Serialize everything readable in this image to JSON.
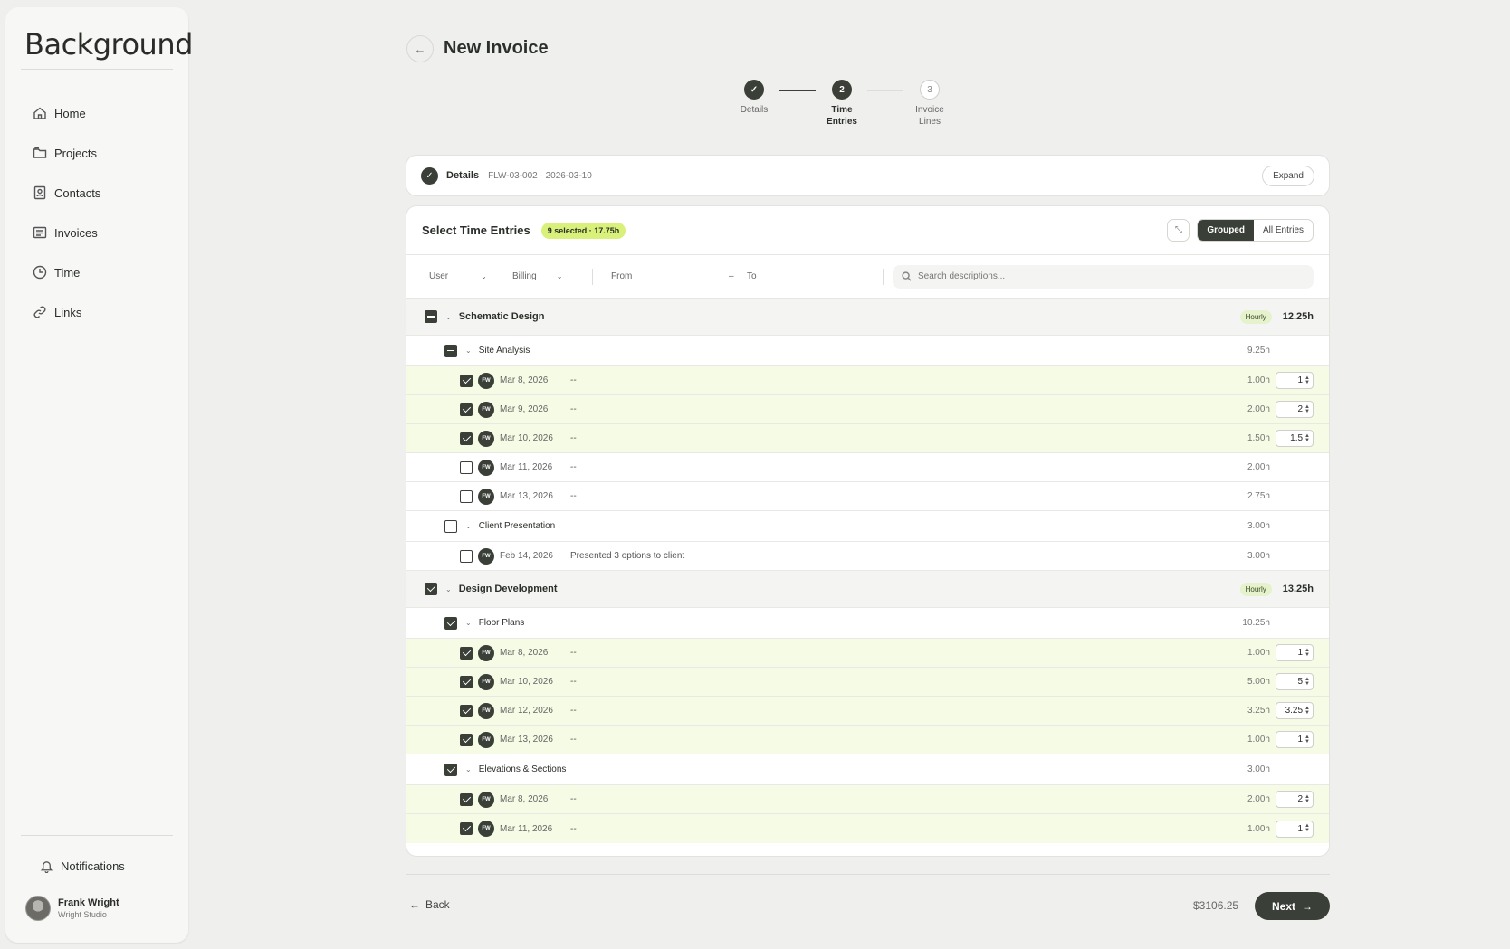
{
  "app": {
    "logo": "Background"
  },
  "sidebar": {
    "items": [
      {
        "label": "Home",
        "icon": "home-icon"
      },
      {
        "label": "Projects",
        "icon": "folder-icon"
      },
      {
        "label": "Contacts",
        "icon": "contact-card-icon"
      },
      {
        "label": "Invoices",
        "icon": "invoice-icon"
      },
      {
        "label": "Time",
        "icon": "clock-icon"
      },
      {
        "label": "Links",
        "icon": "link-icon"
      }
    ],
    "notifications": "Notifications",
    "user": {
      "name": "Frank Wright",
      "org": "Wright Studio"
    }
  },
  "page": {
    "title": "New Invoice"
  },
  "stepper": [
    {
      "num": "✓",
      "label": "Details",
      "state": "done"
    },
    {
      "num": "2",
      "label": "Time Entries",
      "state": "active"
    },
    {
      "num": "3",
      "label": "Invoice Lines",
      "state": "todo"
    }
  ],
  "details": {
    "title": "Details",
    "meta": "FLW-03-002 · 2026-03-10",
    "expand": "Expand"
  },
  "entries": {
    "title": "Select Time Entries",
    "badge": "9 selected · 17.75h",
    "view_grouped": "Grouped",
    "view_all": "All Entries",
    "filters": {
      "user": "User",
      "billing": "Billing",
      "from": "From",
      "dash": "–",
      "to": "To",
      "search_placeholder": "Search descriptions..."
    },
    "groups": [
      {
        "name": "Schematic Design",
        "billing": "Hourly",
        "total": "12.25h",
        "state": "partial",
        "subgroups": [
          {
            "name": "Site Analysis",
            "total": "9.25h",
            "state": "partial",
            "rows": [
              {
                "initials": "FW",
                "date": "Mar 8, 2026",
                "desc": "--",
                "hours": "1.00h",
                "qty": "1",
                "selected": true
              },
              {
                "initials": "FW",
                "date": "Mar 9, 2026",
                "desc": "--",
                "hours": "2.00h",
                "qty": "2",
                "selected": true
              },
              {
                "initials": "FW",
                "date": "Mar 10, 2026",
                "desc": "--",
                "hours": "1.50h",
                "qty": "1.5",
                "selected": true
              },
              {
                "initials": "FW",
                "date": "Mar 11, 2026",
                "desc": "--",
                "hours": "2.00h",
                "qty": "",
                "selected": false
              },
              {
                "initials": "FW",
                "date": "Mar 13, 2026",
                "desc": "--",
                "hours": "2.75h",
                "qty": "",
                "selected": false
              }
            ]
          },
          {
            "name": "Client Presentation",
            "total": "3.00h",
            "state": "none",
            "rows": [
              {
                "initials": "FW",
                "date": "Feb 14, 2026",
                "desc": "Presented 3 options to client",
                "hours": "3.00h",
                "qty": "",
                "selected": false
              }
            ]
          }
        ]
      },
      {
        "name": "Design Development",
        "billing": "Hourly",
        "total": "13.25h",
        "state": "checked",
        "subgroups": [
          {
            "name": "Floor Plans",
            "total": "10.25h",
            "state": "checked",
            "rows": [
              {
                "initials": "FW",
                "date": "Mar 8, 2026",
                "desc": "--",
                "hours": "1.00h",
                "qty": "1",
                "selected": true
              },
              {
                "initials": "FW",
                "date": "Mar 10, 2026",
                "desc": "--",
                "hours": "5.00h",
                "qty": "5",
                "selected": true
              },
              {
                "initials": "FW",
                "date": "Mar 12, 2026",
                "desc": "--",
                "hours": "3.25h",
                "qty": "3.25",
                "selected": true
              },
              {
                "initials": "FW",
                "date": "Mar 13, 2026",
                "desc": "--",
                "hours": "1.00h",
                "qty": "1",
                "selected": true
              }
            ]
          },
          {
            "name": "Elevations & Sections",
            "total": "3.00h",
            "state": "checked",
            "rows": [
              {
                "initials": "FW",
                "date": "Mar 8, 2026",
                "desc": "--",
                "hours": "2.00h",
                "qty": "2",
                "selected": true
              },
              {
                "initials": "FW",
                "date": "Mar 11, 2026",
                "desc": "--",
                "hours": "1.00h",
                "qty": "1",
                "selected": true
              }
            ]
          }
        ]
      }
    ]
  },
  "footer": {
    "back": "Back",
    "total": "$3106.25",
    "next": "Next"
  },
  "colors": {
    "primary": "#3a3f38",
    "badge": "#d9f07a",
    "selected_row": "#f5fbe4"
  }
}
